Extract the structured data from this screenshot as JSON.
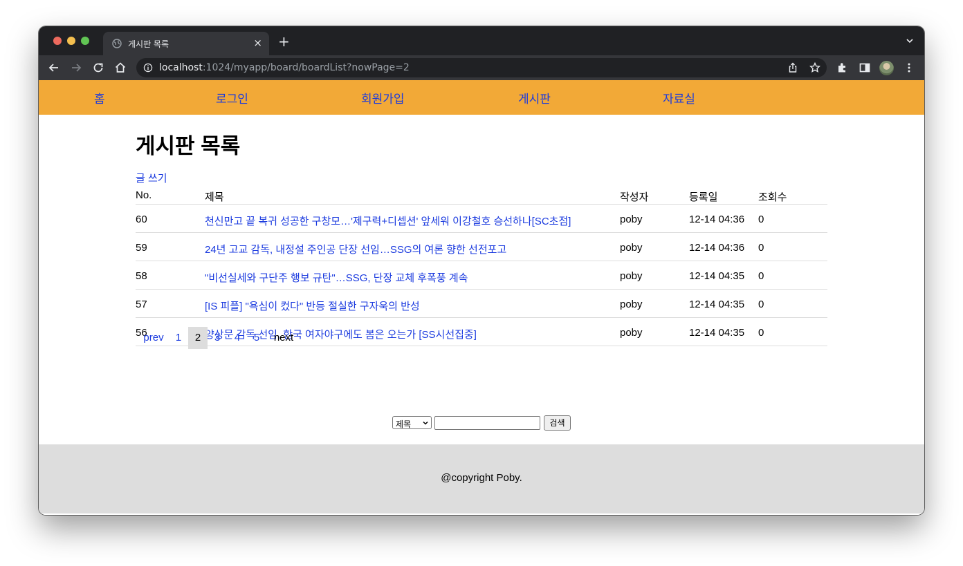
{
  "browser": {
    "tab_title": "게시판 목록",
    "tab_close": "×",
    "new_tab": "+",
    "url_host": "localhost",
    "url_path": ":1024/myapp/board/boardList?nowPage=2",
    "icons": [
      "back-icon",
      "forward-icon",
      "reload-icon",
      "home-icon",
      "info-icon",
      "share-icon",
      "star-icon",
      "extensions-icon",
      "side-panel-icon",
      "profile-avatar",
      "more-icon",
      "tab-list-icon"
    ]
  },
  "nav": {
    "items": [
      {
        "label": "홈"
      },
      {
        "label": "로그인"
      },
      {
        "label": "회원가입"
      },
      {
        "label": "게시판"
      },
      {
        "label": "자료실"
      }
    ]
  },
  "board": {
    "title": "게시판 목록",
    "write_link": "글 쓰기",
    "headers": {
      "no": "No.",
      "title": "제목",
      "writer": "작성자",
      "date": "등록일",
      "hits": "조회수"
    },
    "rows": [
      {
        "no": "60",
        "title": "천신만고 끝 복귀 성공한 구창모…'제구력+디셉션' 앞세워 이강철호 승선하나[SC초점]",
        "writer": "poby",
        "date": "12-14 04:36",
        "hits": "0"
      },
      {
        "no": "59",
        "title": "24년 고교 감독, 내정설 주인공 단장 선임…SSG의 여론 향한 선전포고",
        "writer": "poby",
        "date": "12-14 04:36",
        "hits": "0"
      },
      {
        "no": "58",
        "title": "\"비선실세와 구단주 행보 규탄\"…SSG, 단장 교체 후폭풍 계속",
        "writer": "poby",
        "date": "12-14 04:35",
        "hits": "0"
      },
      {
        "no": "57",
        "title": "[IS 피플] \"욕심이 컸다\" 반등 절실한 구자욱의 반성",
        "writer": "poby",
        "date": "12-14 04:35",
        "hits": "0"
      },
      {
        "no": "56",
        "title": "양상문 감독 선임, 한국 여자야구에도 봄은 오는가 [SS시선집중]",
        "writer": "poby",
        "date": "12-14 04:35",
        "hits": "0"
      }
    ]
  },
  "pagination": {
    "prev": "prev",
    "pages": [
      "1",
      "2",
      "3",
      "4",
      "5"
    ],
    "current": "2",
    "next": "next"
  },
  "search": {
    "field_selected": "제목",
    "query": "",
    "button": "검색"
  },
  "footer": {
    "text": "@copyright Poby."
  },
  "colors": {
    "nav_bg": "#f2a937",
    "link": "#1a3adf",
    "footer_bg": "#dddddd",
    "chrome_dark": "#202124",
    "chrome_toolbar": "#35363a"
  }
}
